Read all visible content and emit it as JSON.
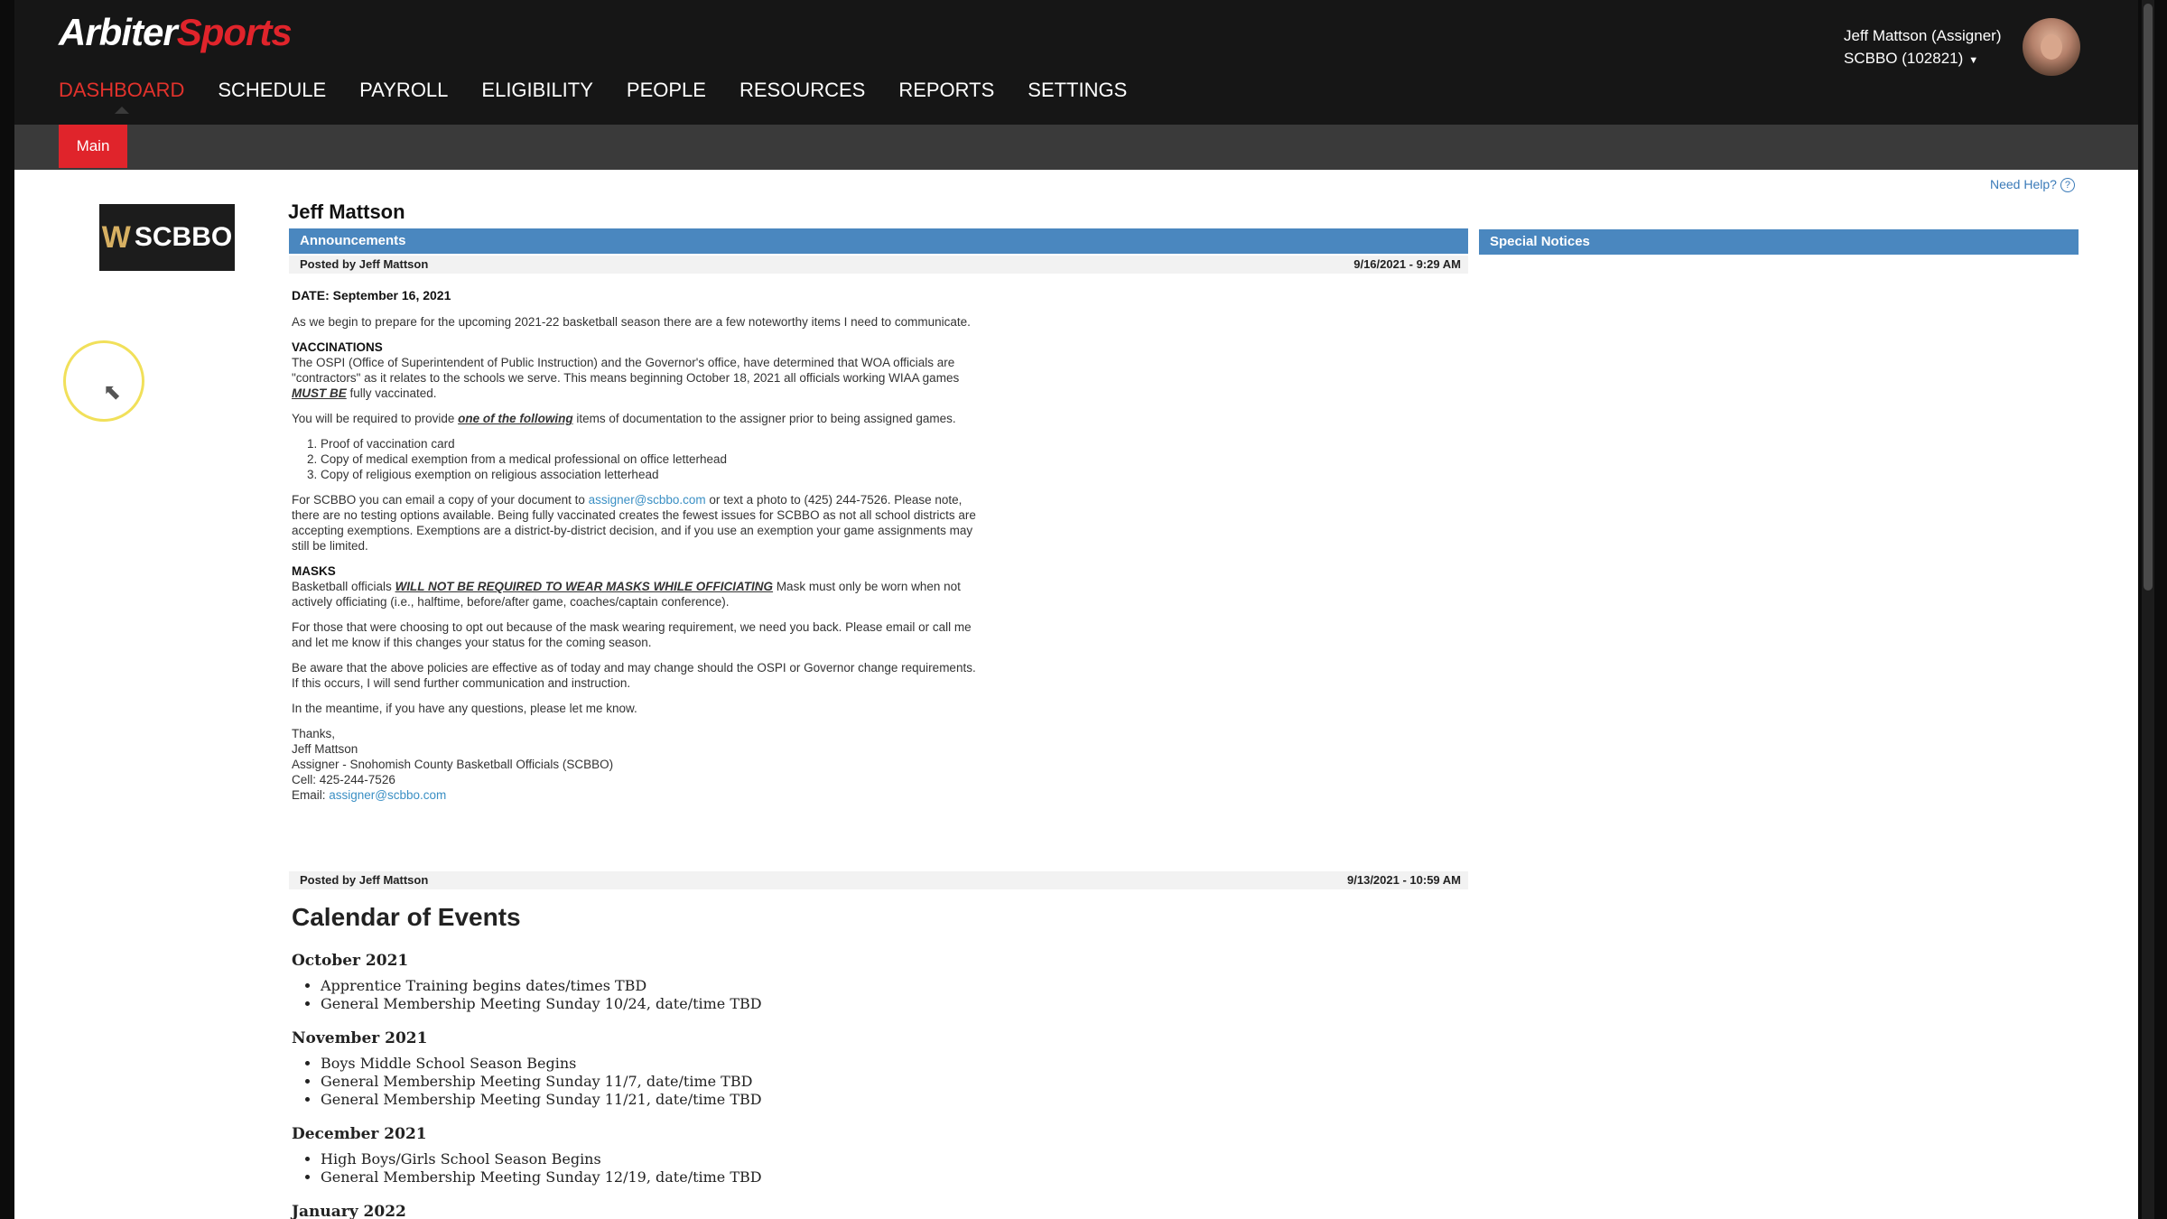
{
  "header": {
    "logo_part1": "Arbiter",
    "logo_part2": "Sports",
    "nav": [
      {
        "label": "DASHBOARD",
        "active": true
      },
      {
        "label": "SCHEDULE"
      },
      {
        "label": "PAYROLL"
      },
      {
        "label": "ELIGIBILITY"
      },
      {
        "label": "PEOPLE"
      },
      {
        "label": "RESOURCES"
      },
      {
        "label": "REPORTS"
      },
      {
        "label": "SETTINGS"
      }
    ],
    "user_name": "Jeff Mattson (Assigner)",
    "user_org": "SCBBO (102821)",
    "sub_tab": "Main",
    "colors": {
      "accent": "#e0242b",
      "bar": "#161616",
      "panel_header": "#4a87bf"
    }
  },
  "sidebar": {
    "org_logo_text": "SCBBO",
    "org_logo_mark": "W"
  },
  "main": {
    "need_help": "Need Help?",
    "person_name": "Jeff Mattson",
    "announcements_title": "Announcements",
    "special_notices_title": "Special Notices",
    "post1": {
      "posted_by": "Posted by Jeff Mattson",
      "date": "9/16/2021 - 9:29 AM",
      "date_line": "DATE: September 16, 2021",
      "intro": "As we begin to prepare for the upcoming 2021-22 basketball season there are a few noteworthy items I need to communicate.",
      "vacc_heading": "VACCINATIONS",
      "vacc_text": "The OSPI (Office of Superintendent of Public Instruction) and the Governor's office, have determined that WOA officials are \"contractors\" as it relates to the schools we serve.  This means beginning October 18, 2021 all officials working WIAA games ",
      "vacc_emph": "MUST BE",
      "vacc_tail": " fully vaccinated.",
      "doc_text1": "You will be required to provide ",
      "doc_emph": "one of the following",
      "doc_text2": " items of documentation to the assigner prior to being assigned games.",
      "doc_list": [
        "Proof of vaccination card",
        "Copy of medical exemption from a medical professional on office letterhead",
        "Copy of religious exemption on religious association letterhead"
      ],
      "email_text1": "For SCBBO you can email a copy of your document to ",
      "email_link": "assigner@scbbo.com",
      "email_text2": " or text a photo to (425) 244-7526.  Please note, there are no testing options available.  Being fully vaccinated creates the fewest issues for SCBBO as not all school districts are accepting exemptions.  Exemptions are a district-by-district decision, and if you use an exemption your game assignments may still be limited.",
      "masks_heading": "MASKS",
      "masks_text1": "Basketball officials ",
      "masks_emph": "WILL NOT BE REQUIRED TO WEAR MASKS WHILE OFFICIATING",
      "masks_text2": "  Mask must only be worn when not actively officiating (i.e., halftime, before/after game, coaches/captain conference).",
      "optout": "For those that were choosing to opt out because of the mask wearing requirement, we need you back.  Please email or call me and let me know if this changes your status for the coming season.",
      "aware": "Be aware that the above policies are effective as of today and may change should the OSPI or Governor change requirements.  If this occurs, I will send further communication and instruction.",
      "meantime": "In the meantime, if you have any questions, please let me know.",
      "sig_thanks": "Thanks,",
      "sig_name": "Jeff Mattson",
      "sig_title": "Assigner - Snohomish County Basketball Officials (SCBBO)",
      "sig_cell": "Cell: 425-244-7526",
      "sig_email_label": "Email: ",
      "sig_email": "assigner@scbbo.com"
    },
    "post2": {
      "posted_by": "Posted by Jeff Mattson",
      "date": "9/13/2021 - 10:59 AM"
    },
    "calendar": {
      "title": "Calendar of Events",
      "months": [
        {
          "name": "October 2021",
          "items": [
            "Apprentice Training begins dates/times TBD",
            "General Membership Meeting Sunday 10/24, date/time TBD"
          ]
        },
        {
          "name": "November 2021",
          "items": [
            "Boys Middle School Season Begins",
            "General Membership Meeting Sunday 11/7, date/time TBD",
            "General Membership Meeting Sunday 11/21, date/time TBD"
          ]
        },
        {
          "name": "December 2021",
          "items": [
            "High Boys/Girls School Season Begins",
            "General Membership Meeting Sunday 12/19, date/time TBD"
          ]
        },
        {
          "name": "January 2022",
          "items": []
        }
      ]
    }
  }
}
